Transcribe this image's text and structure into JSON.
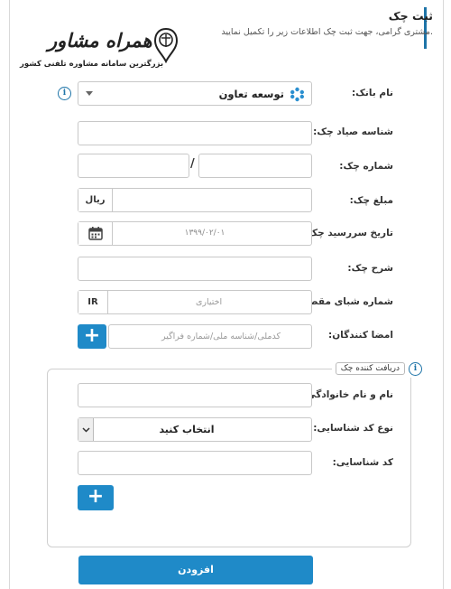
{
  "header": {
    "title": "ثبت چک",
    "subtitle": "مشتری گرامی، جهت ثبت چک اطلاعات زیر را تکمیل نمایید."
  },
  "logo": {
    "name": "همراه مشاور",
    "tagline": "بزرگترین سامانه مشاوره تلفنی کشور",
    "icon": "scales-badge-icon"
  },
  "form": {
    "bank": {
      "label": "نام بانک:",
      "value": "توسعه تعاون",
      "icon": "bank-logo-icon"
    },
    "sayad": {
      "label": "شناسه صیاد چک:",
      "value": ""
    },
    "cheque_number": {
      "label": "شماره چک:",
      "separator": "/"
    },
    "amount": {
      "label": "مبلغ چک:",
      "currency": "ریال"
    },
    "due_date": {
      "label": "تاریخ سررسید چک:",
      "value": "۱۳۹۹/۰۲/۰۱",
      "icon": "calendar-icon"
    },
    "description": {
      "label": "شرح چک:"
    },
    "iban": {
      "label": "شماره شبای مقصد:",
      "prefix": "IR",
      "placeholder": "اختیاری"
    },
    "signers": {
      "label": "امضا کنندگان:",
      "placeholder": "کدملی/شناسه ملی/شماره فراگیر",
      "add": "+"
    }
  },
  "receiver": {
    "legend": "دریافت کننده چک",
    "full_name": {
      "label": "نام و نام خانوادگی:"
    },
    "id_type": {
      "label": "نوع کد شناسایی:",
      "value": "انتخاب کنید"
    },
    "id_code": {
      "label": "کد شناسایی:"
    },
    "add": "+"
  },
  "submit_label": "افزودن",
  "colors": {
    "accent": "#1f8ac8",
    "border": "#c8c8c8"
  }
}
